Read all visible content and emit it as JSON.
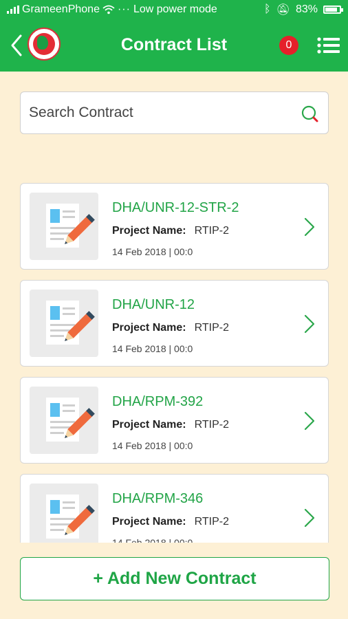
{
  "status_bar": {
    "carrier": "GrameenPhone",
    "mode": "Low power mode",
    "battery": "83%",
    "battery_level": 0.83
  },
  "header": {
    "title": "Contract List",
    "notification_count": "0"
  },
  "search": {
    "placeholder": "Search Contract",
    "value": ""
  },
  "contracts": [
    {
      "code": "DHA/UNR-12-STR-2",
      "project_label": "Project Name:",
      "project": "RTIP-2",
      "date": "14 Feb 2018  |  00:0"
    },
    {
      "code": "DHA/UNR-12",
      "project_label": "Project Name:",
      "project": "RTIP-2",
      "date": "14 Feb 2018  |  00:0"
    },
    {
      "code": "DHA/RPM-392",
      "project_label": "Project Name:",
      "project": "RTIP-2",
      "date": "14 Feb 2018  |  00:0"
    },
    {
      "code": "DHA/RPM-346",
      "project_label": "Project Name:",
      "project": "RTIP-2",
      "date": "14 Feb 2018  |  00:0"
    }
  ],
  "actions": {
    "add_label": "+ Add New Contract"
  },
  "colors": {
    "brand_green": "#1fb34b",
    "background": "#fdf0d5",
    "badge_red": "#e5202a"
  }
}
